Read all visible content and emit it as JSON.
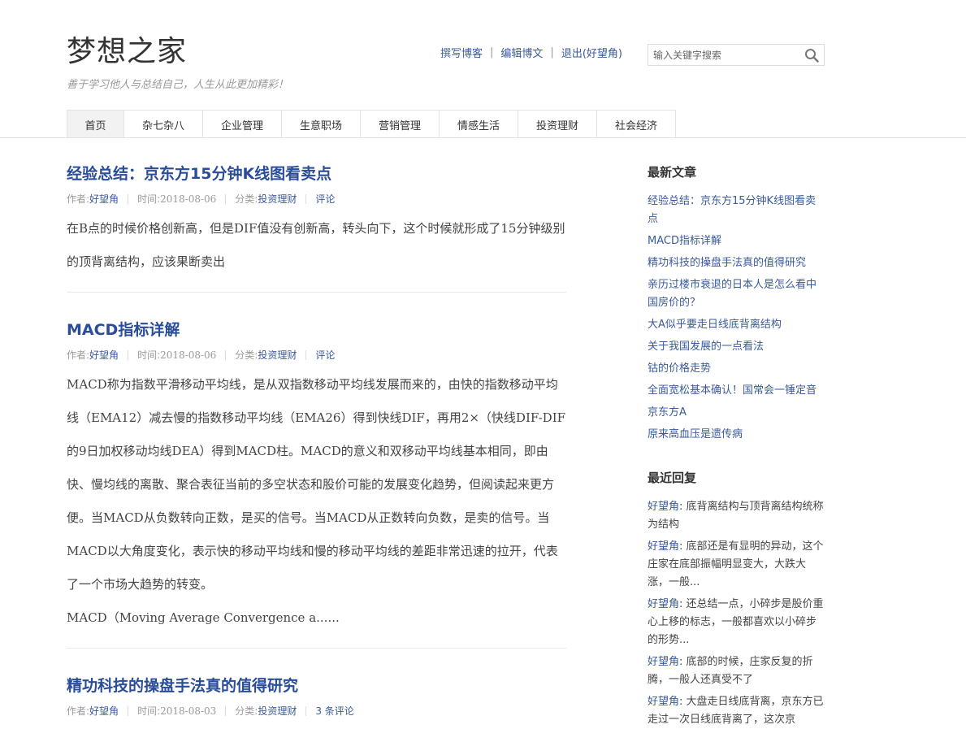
{
  "site": {
    "title": "梦想之家",
    "description": "善于学习他人与总结自己，人生从此更加精彩！"
  },
  "topnav": {
    "write": "撰写博客",
    "edit": "编辑博文",
    "logout": "退出(好望角)",
    "separator": "|"
  },
  "search": {
    "placeholder": "输入关键字搜索",
    "icon": "search-icon"
  },
  "nav": [
    {
      "label": "首页",
      "active": true
    },
    {
      "label": "杂七杂八"
    },
    {
      "label": "企业管理"
    },
    {
      "label": "生意职场"
    },
    {
      "label": "营销管理"
    },
    {
      "label": "情感生活"
    },
    {
      "label": "投资理财"
    },
    {
      "label": "社会经济"
    }
  ],
  "meta_labels": {
    "author": "作者:",
    "time": "时间:",
    "category": "分类:"
  },
  "posts": [
    {
      "title": "经验总结：京东方15分钟K线图看卖点",
      "author": "好望角",
      "date": "2018-08-06",
      "category": "投资理财",
      "comments": "评论",
      "excerpt": [
        "在B点的时候价格创新高，但是DIF值没有创新高，转头向下，这个时候就形成了15分钟级别的顶背离结构，应该果断卖出"
      ]
    },
    {
      "title": "MACD指标详解",
      "author": "好望角",
      "date": "2018-08-06",
      "category": "投资理财",
      "comments": "评论",
      "excerpt": [
        "MACD称为指数平滑移动平均线，是从双指数移动平均线发展而来的，由快的指数移动平均线（EMA12）减去慢的指数移动平均线（EMA26）得到快线DIF，再用2×（快线DIF-DIF的9日加权移动均线DEA）得到MACD柱。MACD的意义和双移动平均线基本相同，即由快、慢均线的离散、聚合表征当前的多空状态和股价可能的发展变化趋势，但阅读起来更方便。当MACD从负数转向正数，是买的信号。当MACD从正数转向负数，是卖的信号。当MACD以大角度变化，表示快的移动平均线和慢的移动平均线的差距非常迅速的拉开，代表了一个市场大趋势的转变。",
        "MACD（Moving Average Convergence a......"
      ]
    },
    {
      "title": "精功科技的操盘手法真的值得研究",
      "author": "好望角",
      "date": "2018-08-03",
      "category": "投资理财",
      "comments": "3 条评论",
      "excerpt": []
    }
  ],
  "sidebar": {
    "recent_title": "最新文章",
    "recent": [
      "经验总结：京东方15分钟K线图看卖点",
      "MACD指标详解",
      "精功科技的操盘手法真的值得研究",
      "亲历过楼市衰退的日本人是怎么看中国房价的？",
      "大A似乎要走日线底背离结构",
      "关于我国发展的一点看法",
      "钴的价格走势",
      "全面宽松基本确认！国常会一锤定音",
      "京东方A",
      "原来高血压是遗传病"
    ],
    "comments_title": "最近回复",
    "comments": [
      {
        "author": "好望角",
        "text": "底背离结构与顶背离结构统称为结构"
      },
      {
        "author": "好望角",
        "text": "底部还是有显明的异动，这个庄家在底部振幅明显变大，大跌大涨，一般..."
      },
      {
        "author": "好望角",
        "text": "还总结一点，小碎步是股价重心上移的标志，一般都喜欢以小碎步的形势..."
      },
      {
        "author": "好望角",
        "text": "底部的时候，庄家反复的折腾，一般人还真受不了"
      },
      {
        "author": "好望角",
        "text": "大盘走日线底背离，京东方已走过一次日线底背离了，这次京"
      }
    ]
  }
}
